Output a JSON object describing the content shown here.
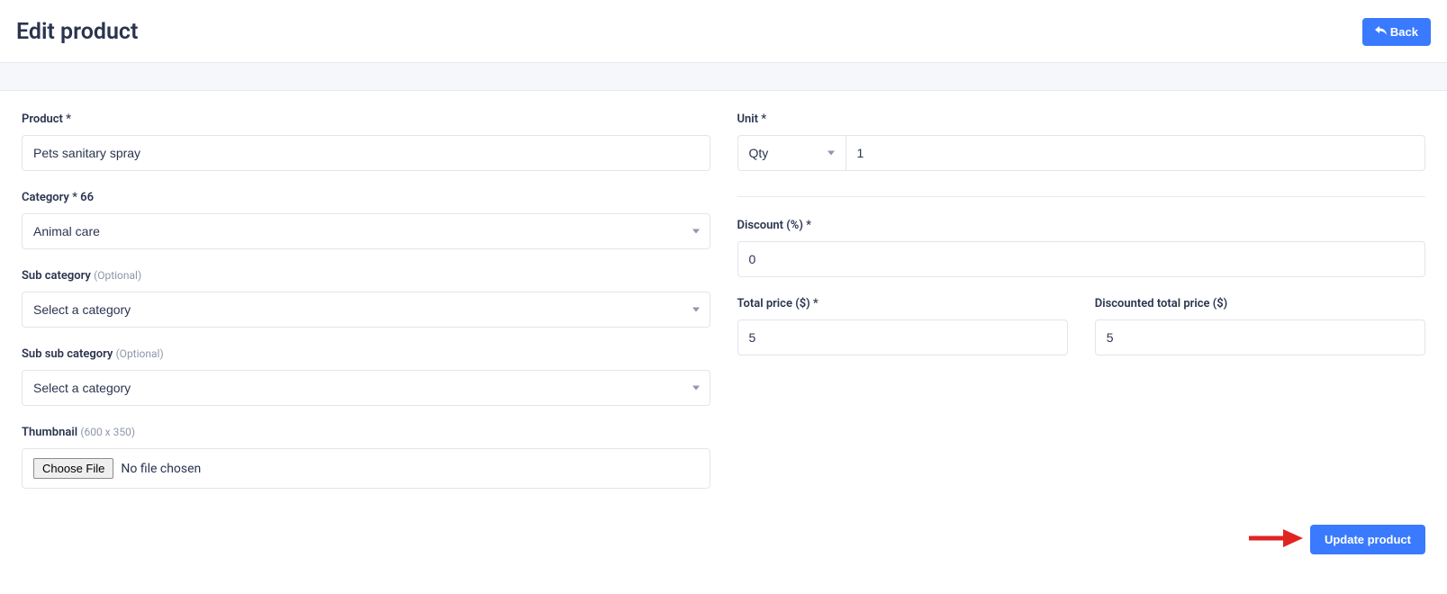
{
  "header": {
    "title": "Edit product",
    "back_label": "Back"
  },
  "left": {
    "product_label": "Product *",
    "product_value": "Pets sanitary spray",
    "category_label": "Category * 66",
    "category_value": "Animal care",
    "subcategory_label": "Sub category ",
    "subcategory_optional": "(Optional)",
    "subcategory_value": "Select a category",
    "subsubcategory_label": "Sub sub category ",
    "subsubcategory_optional": "(Optional)",
    "subsubcategory_value": "Select a category",
    "thumbnail_label": "Thumbnail ",
    "thumbnail_hint": "(600 x 350)",
    "choose_file_label": "Choose File",
    "no_file_label": "No file chosen"
  },
  "right": {
    "unit_label": "Unit *",
    "unit_select_value": "Qty",
    "unit_input_value": "1",
    "discount_label": "Discount (%) *",
    "discount_value": "0",
    "total_price_label": "Total price ($) *",
    "total_price_value": "5",
    "discounted_total_label": "Discounted total price ($)",
    "discounted_total_value": "5"
  },
  "actions": {
    "update_label": "Update product"
  }
}
